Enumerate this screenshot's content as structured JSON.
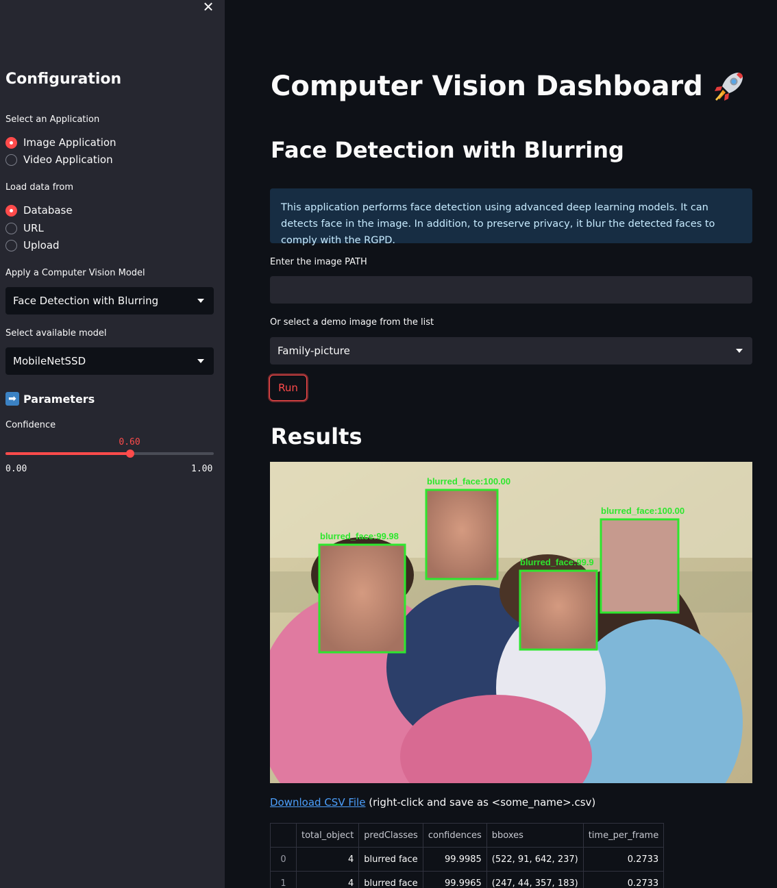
{
  "sidebar": {
    "close_icon": "close-icon",
    "title": "Configuration",
    "application": {
      "label": "Select an Application",
      "options": [
        "Image Application",
        "Video Application"
      ],
      "selected": "Image Application"
    },
    "load_data": {
      "label": "Load data from",
      "options": [
        "Database",
        "URL",
        "Upload"
      ],
      "selected": "Database"
    },
    "cv_model": {
      "label": "Apply a Computer Vision Model",
      "value": "Face Detection with Blurring"
    },
    "available_model": {
      "label": "Select available model",
      "value": "MobileNetSSD"
    },
    "parameters": {
      "icon": "arrow-right-icon",
      "title": "Parameters"
    },
    "confidence": {
      "label": "Confidence",
      "value": "0.60",
      "value_fraction": 0.6,
      "min": "0.00",
      "max": "1.00"
    }
  },
  "main": {
    "title": "Computer Vision Dashboard",
    "title_icon": "rocket-icon",
    "subtitle": "Face Detection with Blurring",
    "info": "This application performs face detection using advanced deep learning models. It can detects face in the image. In addition, to preserve privacy, it blur the detected faces to comply with the RGPD.",
    "path_input": {
      "label": "Enter the image PATH",
      "value": ""
    },
    "demo_select": {
      "label": "Or select a demo image from the list",
      "value": "Family-picture"
    },
    "run_label": "Run",
    "results_title": "Results",
    "detections": [
      {
        "label": "blurred_face:100.00"
      },
      {
        "label": "blurred_face:100.00"
      },
      {
        "label": "blurred_face:99.98"
      },
      {
        "label": "blurred_face:99.9"
      }
    ],
    "download": {
      "link": "Download CSV File",
      "note": "(right-click and save as <some_name>.csv)"
    },
    "table": {
      "columns": [
        "",
        "total_object",
        "predClasses",
        "confidences",
        "bboxes",
        "time_per_frame"
      ],
      "rows": [
        [
          "0",
          "4",
          "blurred face",
          "99.9985",
          "(522, 91, 642, 237)",
          "0.2733"
        ],
        [
          "1",
          "4",
          "blurred face",
          "99.9965",
          "(247, 44, 357, 183)",
          "0.2733"
        ]
      ]
    }
  },
  "colors": {
    "accent": "#ff4b4b",
    "sidebar_bg": "#262730",
    "main_bg": "#0e1117",
    "info_bg": "#172d43",
    "link": "#4c9ffb",
    "detection_box": "#2ee62e"
  }
}
